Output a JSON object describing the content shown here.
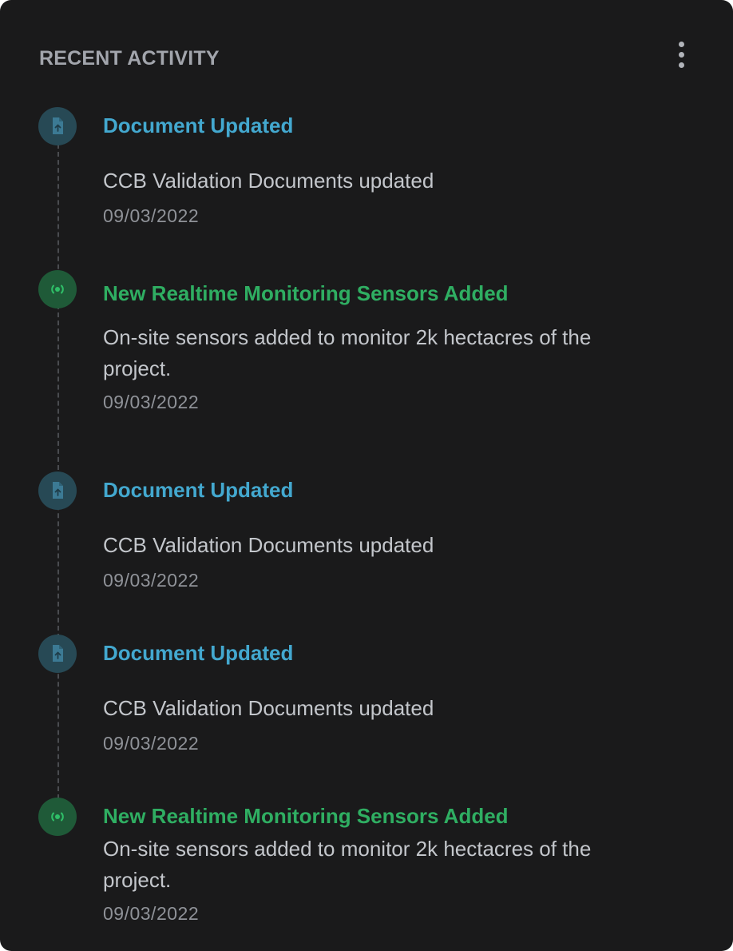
{
  "panel": {
    "title": "RECENT ACTIVITY",
    "menu_icon": "kebab-vertical-icon"
  },
  "colors": {
    "background": "#1a1a1b",
    "document_accent": "#43a8cf",
    "sensor_accent": "#2fae62",
    "title_gray": "#a2a5ac"
  },
  "activities": [
    {
      "type": "document",
      "icon": "file-upload-icon",
      "title": "Document Updated",
      "description": "CCB Validation Documents updated",
      "date": "09/03/2022"
    },
    {
      "type": "sensor",
      "icon": "broadcast-sensor-icon",
      "title": "New Realtime Monitoring Sensors Added",
      "description": "On-site sensors added to monitor 2k hectacres of the project.",
      "date": "09/03/2022"
    },
    {
      "type": "document",
      "icon": "file-upload-icon",
      "title": "Document Updated",
      "description": "CCB Validation Documents updated",
      "date": "09/03/2022"
    },
    {
      "type": "document",
      "icon": "file-upload-icon",
      "title": "Document Updated",
      "description": "CCB Validation Documents updated",
      "date": "09/03/2022"
    },
    {
      "type": "sensor",
      "icon": "broadcast-sensor-icon",
      "title": "New Realtime Monitoring Sensors Added",
      "description": "On-site sensors added to monitor 2k hectacres of the project.",
      "date": "09/03/2022"
    }
  ]
}
